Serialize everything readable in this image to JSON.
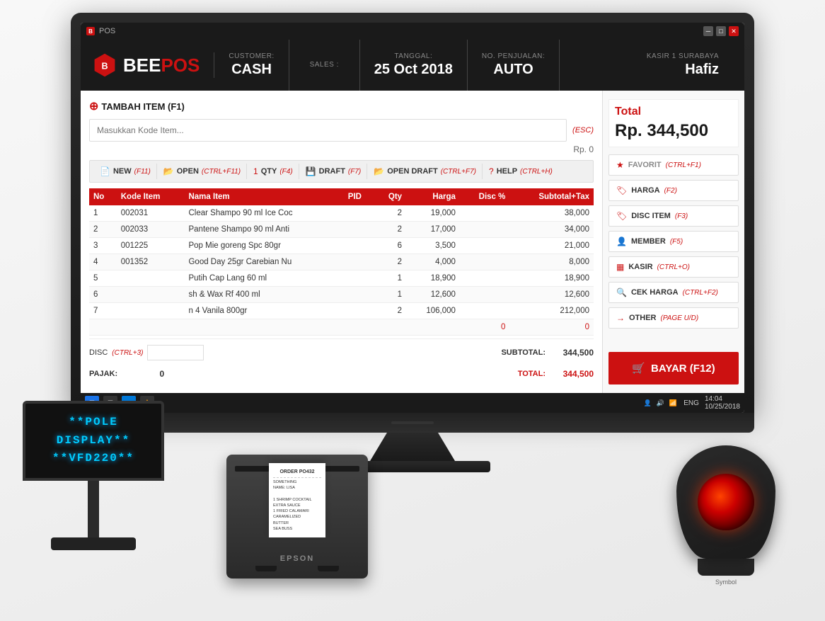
{
  "window": {
    "title": "POS"
  },
  "header": {
    "customer_label": "CUSTOMER:",
    "customer_value": "CASH",
    "sales_label": "SALES :",
    "sales_value": "",
    "tanggal_label": "TANGGAL:",
    "tanggal_value": "25 Oct 2018",
    "no_penjualan_label": "NO. PENJUALAN:",
    "no_penjualan_value": "AUTO",
    "kasir_label": "Kasir 1 Surabaya",
    "kasir_value": "Hafiz"
  },
  "add_item": {
    "label": "TAMBAH ITEM (F1)",
    "placeholder": "Masukkan Kode Item...",
    "esc_label": "(ESC)",
    "rp_value": "Rp. 0"
  },
  "toolbar": {
    "buttons": [
      {
        "icon": "📄",
        "label": "NEW",
        "key": "(F11)"
      },
      {
        "icon": "📂",
        "label": "OPEN",
        "key": "(CTRL+F11)"
      },
      {
        "icon": "1",
        "label": "QTY",
        "key": "(F4)"
      },
      {
        "icon": "💾",
        "label": "DRAFT",
        "key": "(F7)"
      },
      {
        "icon": "📂",
        "label": "OPEN DRAFT",
        "key": "(CTRL+F7)"
      },
      {
        "icon": "?",
        "label": "HELP",
        "key": "(CTRL+H)"
      }
    ]
  },
  "table": {
    "headers": [
      "No",
      "Kode Item",
      "Nama Item",
      "PID",
      "Qty",
      "Harga",
      "Disc %",
      "Subtotal+Tax"
    ],
    "rows": [
      {
        "no": "1",
        "kode": "002031",
        "nama": "Clear Shampo 90 ml Ice Coc",
        "pid": "",
        "qty": "2",
        "harga": "19,000",
        "disc": "",
        "subtotal": "38,000"
      },
      {
        "no": "2",
        "kode": "002033",
        "nama": "Pantene Shampo 90 ml Anti",
        "pid": "",
        "qty": "2",
        "harga": "17,000",
        "disc": "",
        "subtotal": "34,000"
      },
      {
        "no": "3",
        "kode": "001225",
        "nama": "Pop Mie goreng Spc 80gr",
        "pid": "",
        "qty": "6",
        "harga": "3,500",
        "disc": "",
        "subtotal": "21,000"
      },
      {
        "no": "4",
        "kode": "001352",
        "nama": "Good Day 25gr Carebian Nu",
        "pid": "",
        "qty": "2",
        "harga": "4,000",
        "disc": "",
        "subtotal": "8,000"
      },
      {
        "no": "5",
        "kode": "",
        "nama": "Putih Cap Lang 60 ml",
        "pid": "",
        "qty": "1",
        "harga": "18,900",
        "disc": "",
        "subtotal": "18,900"
      },
      {
        "no": "6",
        "kode": "",
        "nama": "sh & Wax Rf 400 ml",
        "pid": "",
        "qty": "1",
        "harga": "12,600",
        "disc": "",
        "subtotal": "12,600"
      },
      {
        "no": "7",
        "kode": "",
        "nama": "n 4 Vanila 800gr",
        "pid": "",
        "qty": "2",
        "harga": "106,000",
        "disc": "",
        "subtotal": "212,000"
      },
      {
        "no": "",
        "kode": "",
        "nama": "",
        "pid": "",
        "qty": "",
        "harga": "",
        "disc": "0",
        "subtotal": "0"
      }
    ]
  },
  "totals": {
    "disc_label": "DISC",
    "disc_key": "(CTRL+3)",
    "subtotal_label": "SUBTOTAL:",
    "subtotal_value": "344,500",
    "pajak_label": "PAJAK:",
    "pajak_value": "0",
    "total_label": "TOTAL:",
    "total_value": "344,500"
  },
  "total_display": {
    "label": "Total",
    "value": "Rp. 344,500"
  },
  "side_buttons": [
    {
      "icon": "★",
      "label": "FAVORIT",
      "key": "(CTRL+F1)",
      "star": true
    },
    {
      "icon": "🏷",
      "label": "HARGA",
      "key": "(F2)"
    },
    {
      "icon": "🏷",
      "label": "DISC ITEM",
      "key": "(F3)"
    },
    {
      "icon": "👤",
      "label": "MEMBER",
      "key": "(F5)"
    },
    {
      "icon": "▦",
      "label": "KASIR",
      "key": "(CTRL+O)"
    },
    {
      "icon": "🔍",
      "label": "CEK HARGA",
      "key": "(CTRL+F2)"
    },
    {
      "icon": "→",
      "label": "OTHER",
      "key": "(PAGE U/D)"
    }
  ],
  "pay_button": {
    "icon": "🛒",
    "label": "BAYAR (F12)"
  },
  "pole_display": {
    "line1": "**POLE DISPLAY**",
    "line2": "**VFD220**"
  },
  "receipt": {
    "title": "ORDER PO432",
    "lines": [
      "SOMETHING",
      "NAME: LISA",
      "",
      "1 SHRIMP COCKTAIL",
      "EXTRA SAUCE",
      "1 FRIED CALAMARI",
      "CARAMELIZED",
      "BUTTER",
      "SEA BUSS"
    ]
  },
  "taskbar": {
    "time": "14:04",
    "date": "10/25/2018",
    "lang": "ENG"
  }
}
